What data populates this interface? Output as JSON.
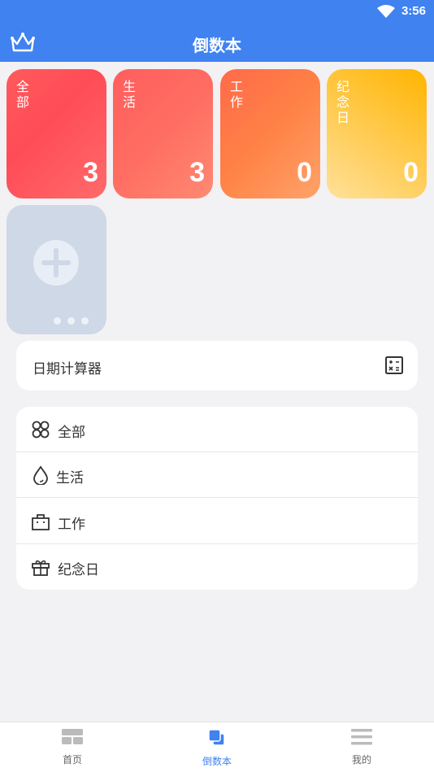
{
  "status": {
    "time": "3:56"
  },
  "appbar": {
    "title": "倒数本"
  },
  "cards": [
    {
      "label": "全部",
      "count": "3"
    },
    {
      "label": "生活",
      "count": "3"
    },
    {
      "label": "工作",
      "count": "0"
    },
    {
      "label": "纪念日",
      "count": "0"
    }
  ],
  "calculator": {
    "label": "日期计算器"
  },
  "categories": [
    {
      "name": "全部",
      "icon": "clover-icon"
    },
    {
      "name": "生活",
      "icon": "drop-icon"
    },
    {
      "name": "工作",
      "icon": "bag-icon"
    },
    {
      "name": "纪念日",
      "icon": "gift-icon"
    }
  ],
  "tabbar": {
    "items": [
      {
        "label": "首页",
        "icon": "home-grid-icon"
      },
      {
        "label": "倒数本",
        "icon": "book-icon",
        "active": true
      },
      {
        "label": "我的",
        "icon": "menu-icon"
      }
    ]
  },
  "colors": {
    "primary": "#3f82f0",
    "background": "#f2f1f4"
  }
}
